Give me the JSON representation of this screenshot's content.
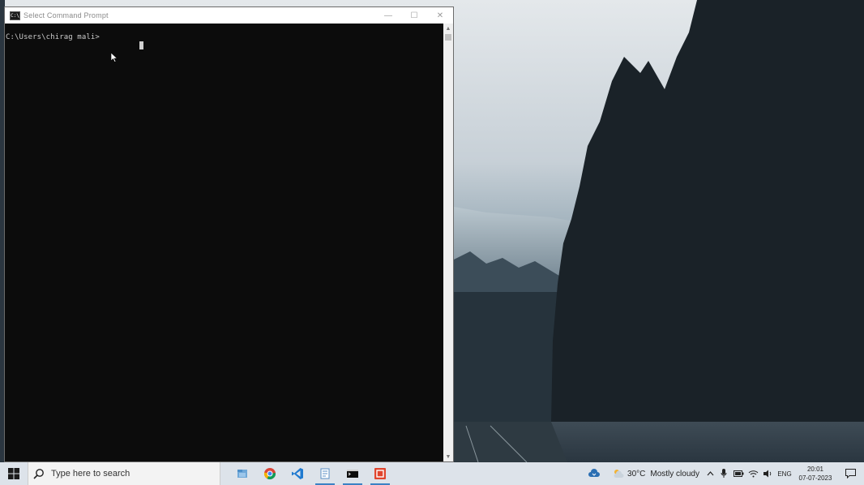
{
  "window": {
    "title": "Select Command Prompt",
    "icon_label": "C:\\",
    "controls": {
      "minimize": "—",
      "maximize": "☐",
      "close": "✕"
    }
  },
  "console": {
    "prompt": "C:\\Users\\chirag mali>"
  },
  "taskbar": {
    "search_placeholder": "Type here to search",
    "apps": [
      {
        "icon": "file-explorer-icon"
      },
      {
        "icon": "chrome-icon"
      },
      {
        "icon": "vscode-icon"
      },
      {
        "icon": "notepad-icon"
      },
      {
        "icon": "command-prompt-icon",
        "active": true
      },
      {
        "icon": "red-app-icon"
      }
    ],
    "weather": {
      "temp": "30°C",
      "desc": "Mostly cloudy"
    },
    "language": "ENG",
    "clock": {
      "time": "20:01",
      "date": "07-07-2023"
    }
  },
  "colors": {
    "console_bg": "#0c0c0c",
    "console_text": "#cccccc",
    "taskbar_bg": "#dde3ea",
    "accent": "#3b82c4"
  }
}
